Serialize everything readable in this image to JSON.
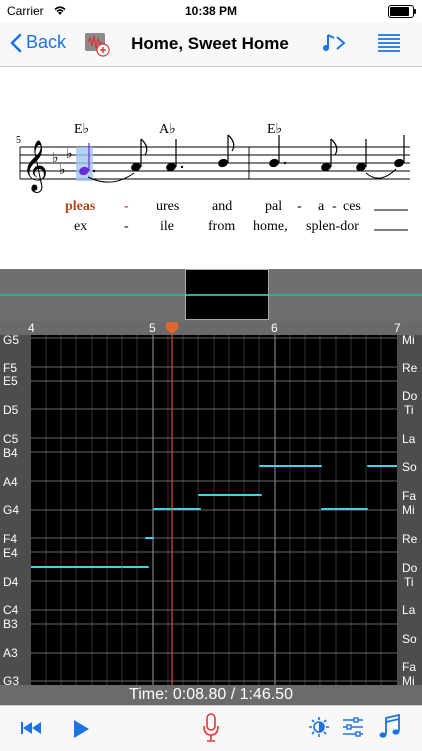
{
  "status": {
    "carrier": "Carrier",
    "time": "10:38 PM"
  },
  "nav": {
    "back_label": "Back",
    "title": "Home, Sweet Home"
  },
  "score": {
    "measure_number": "5",
    "chords": [
      "E♭",
      "A♭",
      "E♭"
    ],
    "lyrics_line1": [
      "pleas",
      "-",
      "ures",
      "and",
      "pal",
      "-",
      "a",
      "-",
      "ces"
    ],
    "lyrics_line2": [
      "ex",
      "-",
      "ile",
      "from",
      "home,",
      "splen-dor"
    ]
  },
  "ruler": {
    "marks": [
      "4",
      "5",
      "6",
      "7"
    ]
  },
  "pitch_labels_left": [
    "G5",
    "F5",
    "E5",
    "D5",
    "C5",
    "B4",
    "A4",
    "G4",
    "F4",
    "E4",
    "D4",
    "C4",
    "B3",
    "A3",
    "G3"
  ],
  "solfege_labels_right": [
    "Mi",
    "Re",
    "Do",
    "Ti",
    "La",
    "So",
    "Fa",
    "Mi",
    "Re",
    "Do",
    "Ti",
    "La",
    "So",
    "Fa",
    "Mi"
  ],
  "time": {
    "text": "Time: 0:08.80 / 1:46.50"
  },
  "colors": {
    "accent": "#1a73e8",
    "record": "#e03a3a",
    "cursor": "#e0662a",
    "pitch": "#3bd6e6",
    "strip_line": "#22b38f"
  },
  "icons": {
    "back": "chevron-left-icon",
    "waveform": "waveform-add-icon",
    "speed": "note-speed-icon",
    "list": "list-icon",
    "rewind": "rewind-icon",
    "play": "play-icon",
    "mic": "microphone-icon",
    "brightness": "brightness-icon",
    "settings": "sliders-icon",
    "music": "music-notes-icon"
  }
}
